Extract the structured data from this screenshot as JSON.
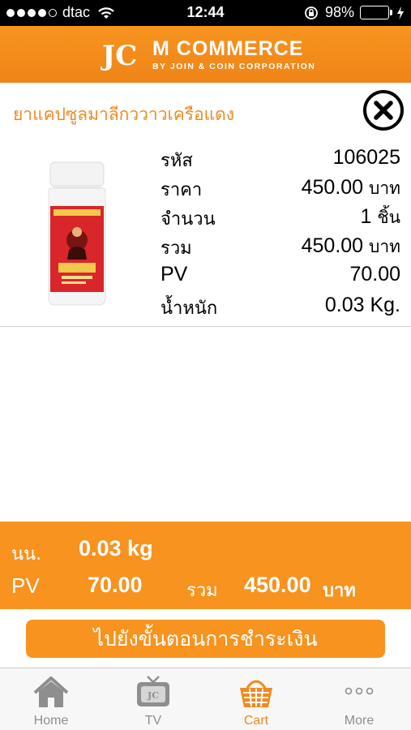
{
  "status_bar": {
    "carrier": "dtac",
    "time": "12:44",
    "battery_percent": "98%",
    "battery_level": 0.98
  },
  "header": {
    "logo_text": "JC",
    "title": "M COMMERCE",
    "subtitle": "BY JOIN & COIN CORPORATION"
  },
  "product": {
    "name": "ยาแคปซูลมาลีกววาวเครือแดง",
    "rows": [
      {
        "label": "รหัส",
        "value": "106025",
        "unit": ""
      },
      {
        "label": "ราคา",
        "value": "450.00",
        "unit": "บาท"
      },
      {
        "label": "จำนวน",
        "value": "1",
        "unit": "ชิ้น"
      },
      {
        "label": "รวม",
        "value": "450.00",
        "unit": "บาท"
      },
      {
        "label": "PV",
        "value": "70.00",
        "unit": ""
      },
      {
        "label": "น้ำหนัก",
        "value": "0.03 Kg.",
        "unit": ""
      }
    ]
  },
  "summary": {
    "weight_label": "นน.",
    "weight_value": "0.03 kg",
    "pv_label": "PV",
    "pv_value": "70.00",
    "total_label": "รวม",
    "total_value": "450.00",
    "total_unit": "บาท"
  },
  "checkout": {
    "label": "ไปยังขั้นตอนการชำระเงิน"
  },
  "tabs": [
    {
      "label": "Home",
      "icon": "home-icon"
    },
    {
      "label": "TV",
      "icon": "tv-icon"
    },
    {
      "label": "Cart",
      "icon": "cart-icon",
      "active": true
    },
    {
      "label": "More",
      "icon": "more-icon"
    }
  ],
  "colors": {
    "accent": "#f7931e",
    "title_text": "#ef8a22",
    "active_tab": "#f08a1c",
    "battery": "#4cd964"
  }
}
